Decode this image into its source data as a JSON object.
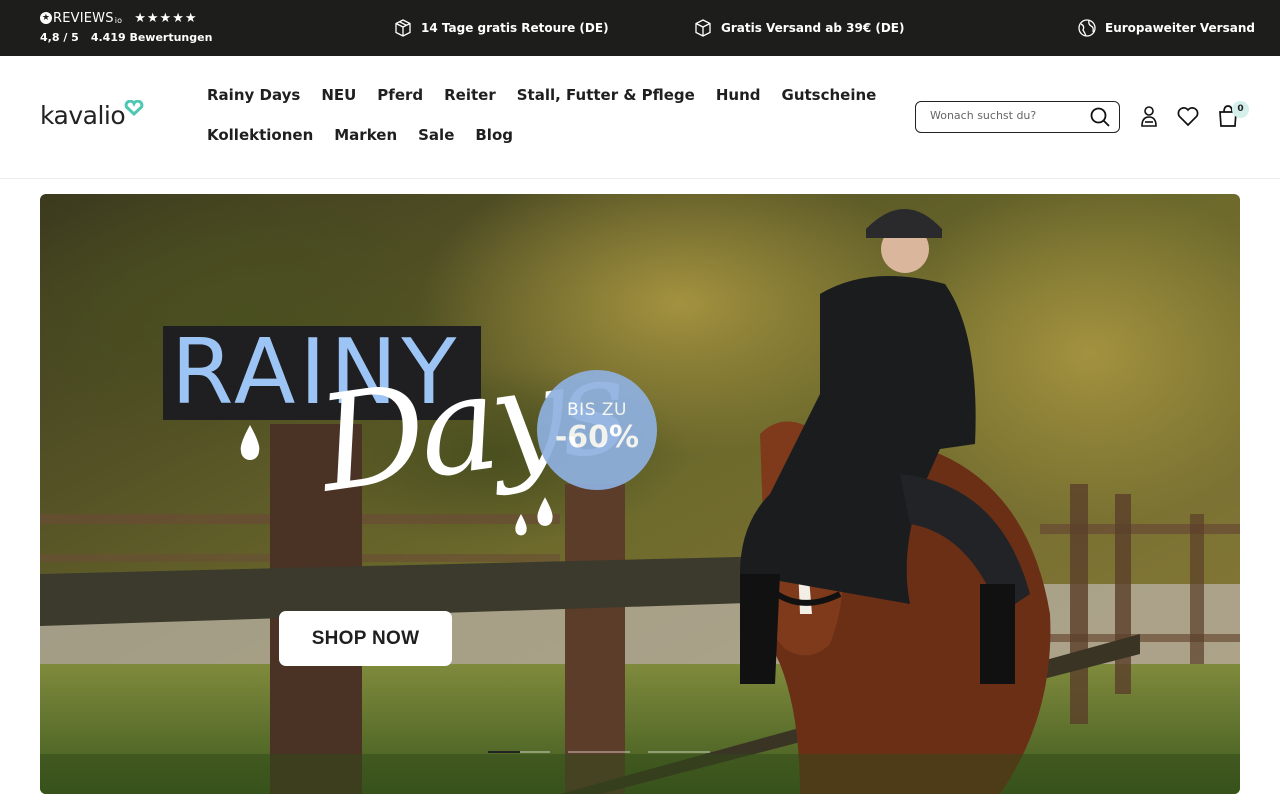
{
  "topbar": {
    "reviews_logo": "REVIEWS",
    "reviews_logo_suffix": "io",
    "stars": "★★★★★",
    "rating": "4,8 / 5",
    "count": "4.419 Bewertungen",
    "usps": [
      {
        "label": "14 Tage gratis Retoure (DE)",
        "icon": "box-return-icon"
      },
      {
        "label": "Gratis Versand ab 39€ (DE)",
        "icon": "package-icon"
      },
      {
        "label": "Europaweiter Versand",
        "icon": "globe-icon"
      }
    ]
  },
  "header": {
    "logo": "kavalio",
    "nav_row1": [
      "Rainy Days",
      "NEU",
      "Pferd",
      "Reiter",
      "Stall, Futter & Pflege",
      "Hund",
      "Gutscheine"
    ],
    "nav_row2": [
      "Kollektionen",
      "Marken",
      "Sale",
      "Blog"
    ],
    "search_placeholder": "Wonach suchst du?",
    "cart_count": "0"
  },
  "hero": {
    "headline": "RAINY",
    "script": "Days",
    "badge_small": "BIS ZU",
    "badge_big": "-60%",
    "cta": "SHOP NOW",
    "slides": 4,
    "active_slide": 1
  },
  "colors": {
    "topbar_bg": "#1d1d1b",
    "brand_accent": "#4fc7b3",
    "rainy_blue": "#9cc4f4",
    "badge_blue": "#8fb1e0"
  }
}
